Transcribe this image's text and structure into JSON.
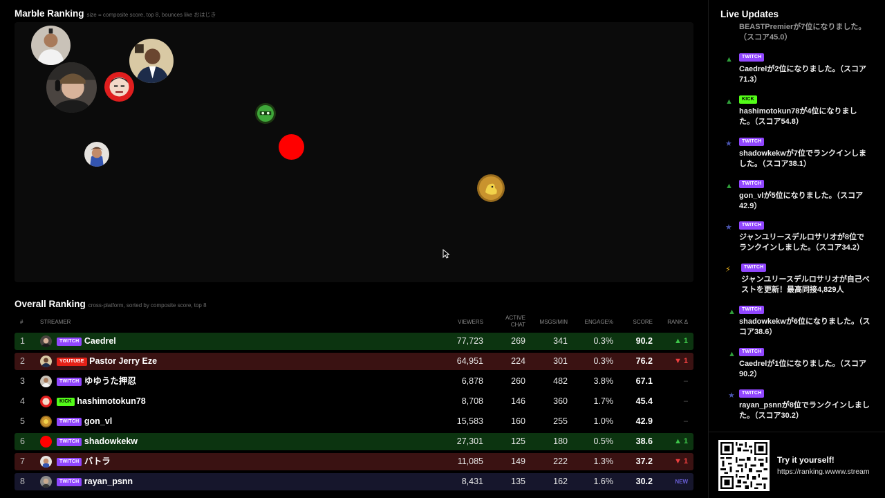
{
  "marble": {
    "title": "Marble Ranking",
    "subtitle": "size = composite score, top 8, bounces like おはじき"
  },
  "overall": {
    "title": "Overall Ranking",
    "subtitle": "cross-platform, sorted by composite score, top 8",
    "columns": {
      "rank": "#",
      "streamer": "STREAMER",
      "viewers": "VIEWERS",
      "active_chat_1": "ACTIVE",
      "active_chat_2": "CHAT",
      "msgs": "MSGS/MIN",
      "engage": "ENGAGE%",
      "score": "SCORE",
      "delta": "RANK Δ"
    },
    "rows": [
      {
        "rank": "1",
        "platform": "TWITCH",
        "name": "Caedrel",
        "viewers": "77,723",
        "chat": "269",
        "msgs": "341",
        "engage": "0.3%",
        "score": "90.2",
        "delta": "▲ 1"
      },
      {
        "rank": "2",
        "platform": "YOUTUBE",
        "name": "Pastor Jerry Eze",
        "viewers": "64,951",
        "chat": "224",
        "msgs": "301",
        "engage": "0.3%",
        "score": "76.2",
        "delta": "▼ 1"
      },
      {
        "rank": "3",
        "platform": "TWITCH",
        "name": "ゆゆうた押忍",
        "viewers": "6,878",
        "chat": "260",
        "msgs": "482",
        "engage": "3.8%",
        "score": "67.1",
        "delta": "–"
      },
      {
        "rank": "4",
        "platform": "KICK",
        "name": "hashimotokun78",
        "viewers": "8,708",
        "chat": "146",
        "msgs": "360",
        "engage": "1.7%",
        "score": "45.4",
        "delta": "–"
      },
      {
        "rank": "5",
        "platform": "TWITCH",
        "name": "gon_vl",
        "viewers": "15,583",
        "chat": "160",
        "msgs": "255",
        "engage": "1.0%",
        "score": "42.9",
        "delta": "–"
      },
      {
        "rank": "6",
        "platform": "TWITCH",
        "name": "shadowkekw",
        "viewers": "27,301",
        "chat": "125",
        "msgs": "180",
        "engage": "0.5%",
        "score": "38.6",
        "delta": "▲ 1"
      },
      {
        "rank": "7",
        "platform": "TWITCH",
        "name": "バトラ",
        "viewers": "11,085",
        "chat": "149",
        "msgs": "222",
        "engage": "1.3%",
        "score": "37.2",
        "delta": "▼ 1"
      },
      {
        "rank": "8",
        "platform": "TWITCH",
        "name": "rayan_psnn",
        "viewers": "8,431",
        "chat": "135",
        "msgs": "162",
        "engage": "1.6%",
        "score": "30.2",
        "delta": "NEW"
      }
    ]
  },
  "live": {
    "title": "Live Updates",
    "items": [
      {
        "icon": "▲",
        "platform": "",
        "text": "BEASTPremierが7位になりました。（スコア45.0）"
      },
      {
        "icon": "▲",
        "platform": "TWITCH",
        "text": "Caedrelが2位になりました。（スコア71.3）"
      },
      {
        "icon": "▲",
        "platform": "KICK",
        "text": "hashimotokun78が4位になりました。（スコア54.8）"
      },
      {
        "icon": "★",
        "platform": "TWITCH",
        "text": "shadowkekwが7位でランクインしました。（スコア38.1）"
      },
      {
        "icon": "▲",
        "platform": "TWITCH",
        "text": "gon_vlが5位になりました。（スコア42.9）"
      },
      {
        "icon": "★",
        "platform": "TWITCH",
        "text": "ジャンユリースデルロサリオが8位でランクインしました。（スコア34.2）"
      },
      {
        "icon": "⚡",
        "platform": "TWITCH",
        "text": "ジャンユリースデルロサリオが自己ベストを更新！最高同接4,829人"
      },
      {
        "icon": "▲",
        "platform": "TWITCH",
        "text": "shadowkekwが6位になりました。（スコア38.6）"
      },
      {
        "icon": "▲",
        "platform": "TWITCH",
        "text": "Caedrelが1位になりました。（スコア90.2）"
      },
      {
        "icon": "★",
        "platform": "TWITCH",
        "text": "rayan_psnnが8位でランクインしました。（スコア30.2）"
      }
    ]
  },
  "footer": {
    "title": "Try it yourself!",
    "url": "https://ranking.wwww.stream"
  }
}
